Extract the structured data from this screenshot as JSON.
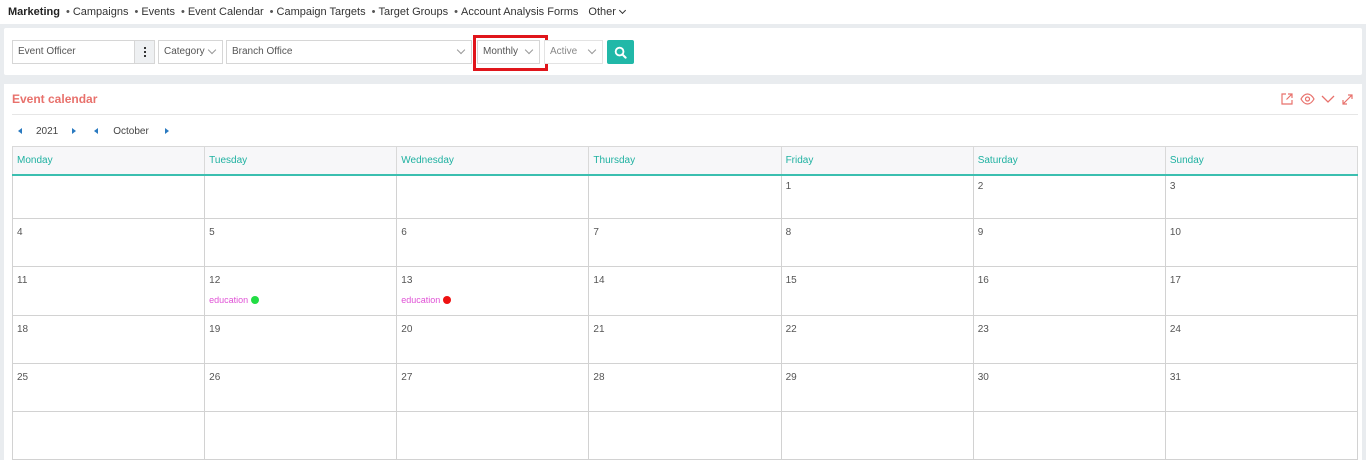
{
  "topnav": {
    "brand": "Marketing",
    "items": [
      "Campaigns",
      "Events",
      "Event Calendar",
      "Campaign Targets",
      "Target Groups",
      "Account Analysis Forms"
    ],
    "bullet": "•",
    "other": "Other"
  },
  "filters": {
    "officer": "Event Officer",
    "category": "Category",
    "branch": "Branch Office",
    "period": "Monthly",
    "status": "Active",
    "search_icon": "search-icon",
    "button_color": "#21b8a8"
  },
  "calendar": {
    "title": "Event calendar",
    "year": "2021",
    "month": "October",
    "tools": [
      "export-icon",
      "eye-icon",
      "chevron-down-icon",
      "expand-icon"
    ],
    "weekdays": [
      "Monday",
      "Tuesday",
      "Wednesday",
      "Thursday",
      "Friday",
      "Saturday",
      "Sunday"
    ],
    "weeks": [
      [
        "",
        "",
        "",
        "",
        "1",
        "2",
        "3"
      ],
      [
        "4",
        "5",
        "6",
        "7",
        "8",
        "9",
        "10"
      ],
      [
        "11",
        "12",
        "13",
        "14",
        "15",
        "16",
        "17"
      ],
      [
        "18",
        "19",
        "20",
        "21",
        "22",
        "23",
        "24"
      ],
      [
        "25",
        "26",
        "27",
        "28",
        "29",
        "30",
        "31"
      ],
      [
        "",
        "",
        "",
        "",
        "",
        "",
        ""
      ]
    ],
    "events": [
      {
        "day": "12",
        "label": "education",
        "status_color": "#22dd44"
      },
      {
        "day": "13",
        "label": "education",
        "status_color": "#ee1111"
      }
    ],
    "accent_color": "#e8716c",
    "header_color": "#1fb1a1"
  }
}
